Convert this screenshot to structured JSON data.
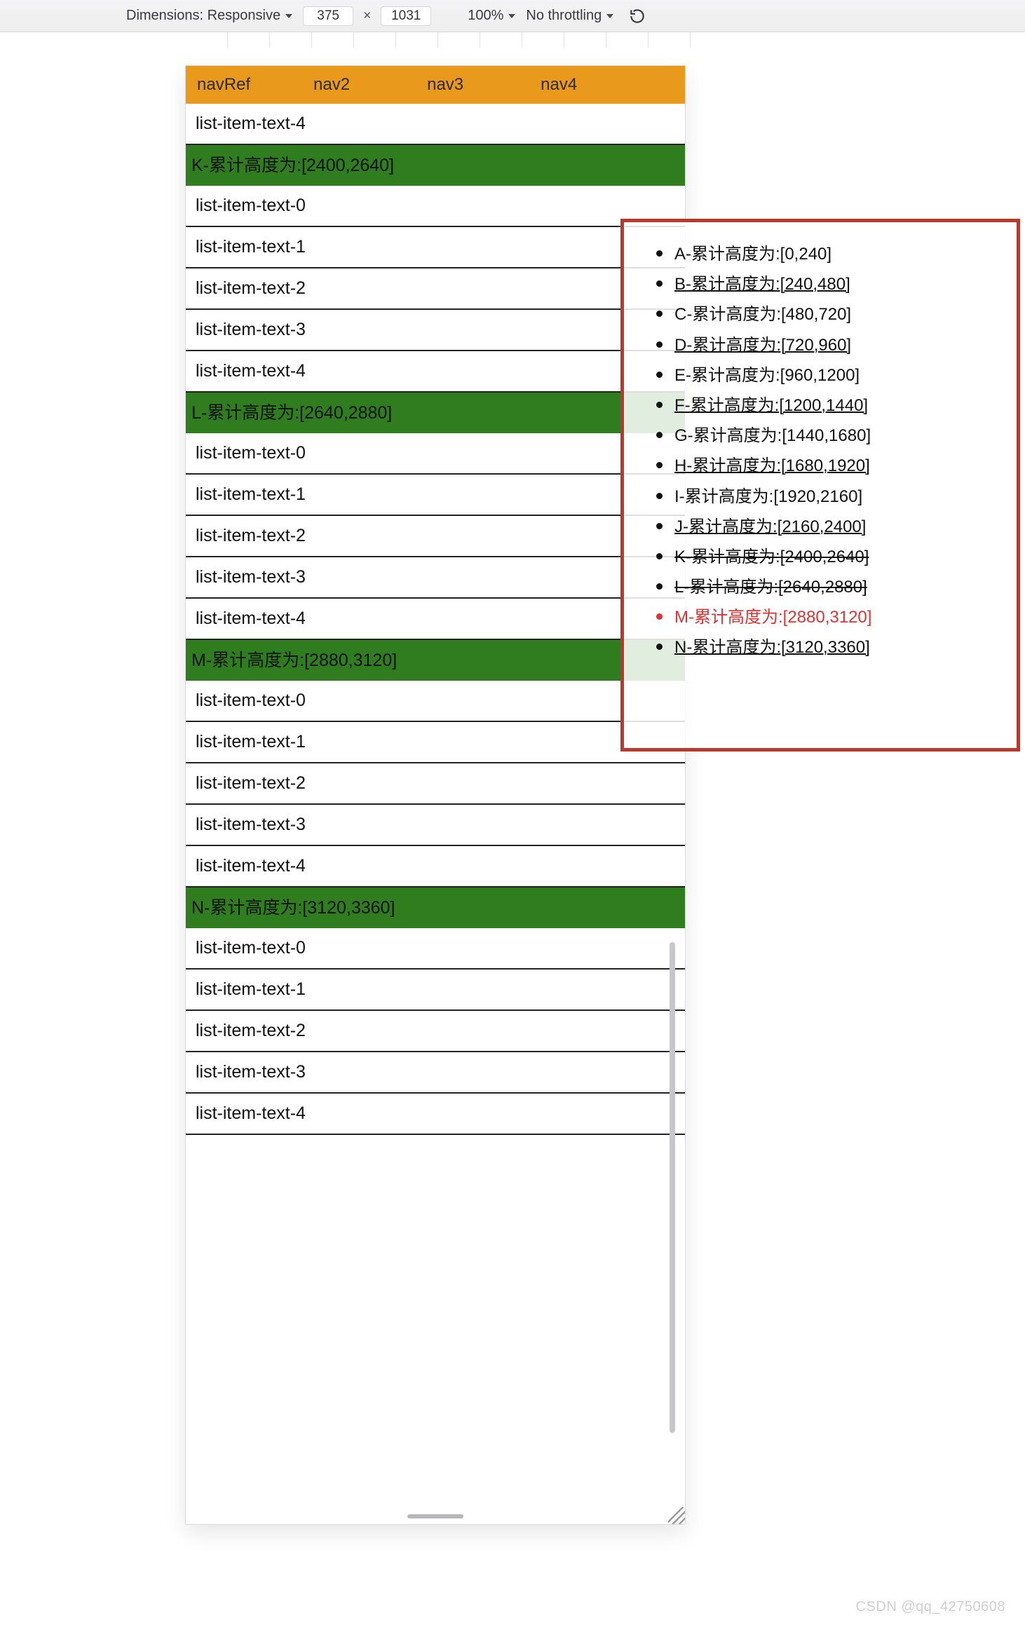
{
  "devtools": {
    "dimensions_label": "Dimensions: Responsive",
    "width": "375",
    "height": "1031",
    "zoom": "100%",
    "throttling": "No throttling"
  },
  "nav": {
    "items": [
      "navRef",
      "nav2",
      "nav3",
      "nav4"
    ]
  },
  "intro_item": "list-item-text-4",
  "sections": [
    {
      "header": "K-累计高度为:[2400,2640]",
      "items": [
        "list-item-text-0",
        "list-item-text-1",
        "list-item-text-2",
        "list-item-text-3",
        "list-item-text-4"
      ]
    },
    {
      "header": "L-累计高度为:[2640,2880]",
      "items": [
        "list-item-text-0",
        "list-item-text-1",
        "list-item-text-2",
        "list-item-text-3",
        "list-item-text-4"
      ]
    },
    {
      "header": "M-累计高度为:[2880,3120]",
      "items": [
        "list-item-text-0",
        "list-item-text-1",
        "list-item-text-2",
        "list-item-text-3",
        "list-item-text-4"
      ]
    },
    {
      "header": "N-累计高度为:[3120,3360]",
      "items": [
        "list-item-text-0",
        "list-item-text-1",
        "list-item-text-2",
        "list-item-text-3",
        "list-item-text-4"
      ]
    }
  ],
  "overlay": {
    "items": [
      {
        "text": "A-累计高度为:[0,240]"
      },
      {
        "text": "B-累计高度为:[240,480]",
        "underline": true
      },
      {
        "text": "C-累计高度为:[480,720]"
      },
      {
        "text": "D-累计高度为:[720,960]",
        "underline": true
      },
      {
        "text": "E-累计高度为:[960,1200]"
      },
      {
        "text": "F-累计高度为:[1200,1440]",
        "underline": true
      },
      {
        "text": "G-累计高度为:[1440,1680]"
      },
      {
        "text": "H-累计高度为:[1680,1920]",
        "underline": true
      },
      {
        "text": "I-累计高度为:[1920,2160]"
      },
      {
        "text": "J-累计高度为:[2160,2400]",
        "underline": true
      },
      {
        "text": "K-累计高度为:[2400,2640]",
        "strike": true
      },
      {
        "text": "L-累计高度为:[2640,2880]",
        "strike": true
      },
      {
        "text": "M-累计高度为:[2880,3120]",
        "hot": true
      },
      {
        "text": "N-累计高度为:[3120,3360]",
        "underline": true
      }
    ]
  },
  "watermark": "CSDN @qq_42750608"
}
